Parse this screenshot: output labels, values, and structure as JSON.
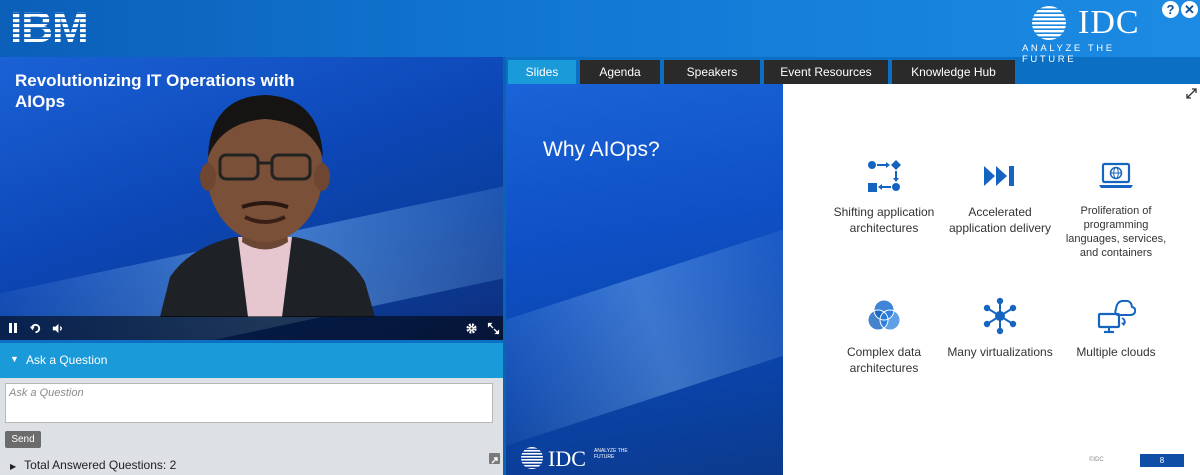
{
  "header": {
    "brand_left": "IBM",
    "brand_right": "IDC",
    "brand_right_tagline": "ANALYZE THE FUTURE",
    "help_label": "?",
    "close_label": "✕"
  },
  "video": {
    "title": "Revolutionizing IT Operations with AIOps",
    "controls": [
      "pause-icon",
      "replay-icon",
      "volume-icon",
      "gear-icon",
      "fullscreen-icon"
    ]
  },
  "ask": {
    "header": "Ask a Question",
    "placeholder": "Ask a Question",
    "send_label": "Send",
    "answered_label": "Total Answered Questions: 2"
  },
  "tabs": [
    "Slides",
    "Agenda",
    "Speakers",
    "Event Resources",
    "Knowledge Hub"
  ],
  "active_tab": "Slides",
  "slide": {
    "title": "Why AIOps?",
    "features": [
      {
        "label": "Shifting application architectures",
        "icon": "architecture-flow-icon"
      },
      {
        "label": "Accelerated application delivery",
        "icon": "fast-forward-icon"
      },
      {
        "label": "Proliferation of programming languages, services, and containers",
        "icon": "laptop-globe-icon"
      },
      {
        "label": "Complex data architectures",
        "icon": "venn-circles-icon"
      },
      {
        "label": "Many virtualizations",
        "icon": "network-hub-icon"
      },
      {
        "label": "Multiple clouds",
        "icon": "cloud-monitor-icon"
      }
    ],
    "footer_logo": "IDC",
    "footer_tagline": "ANALYZE THE FUTURE",
    "copyright": "©IDC",
    "page_number": "8"
  },
  "colors": {
    "accent": "#1a9ad8",
    "icon_blue": "#1565c0",
    "tab_dark": "#2a2a2a"
  }
}
